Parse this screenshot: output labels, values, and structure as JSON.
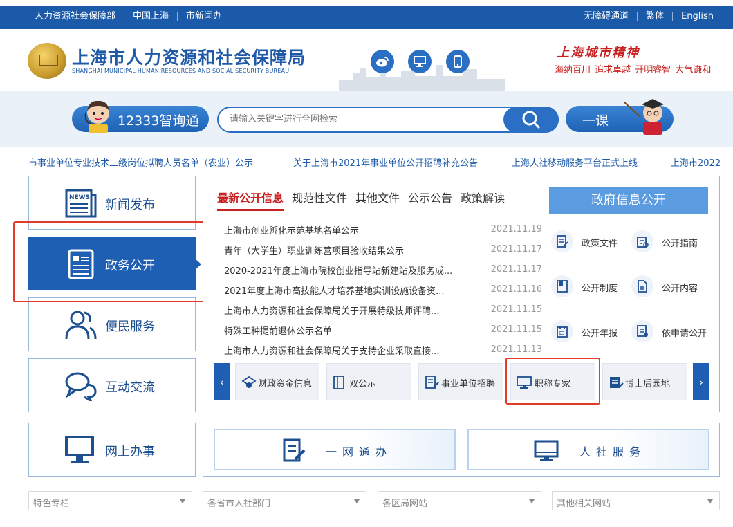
{
  "topbar": {
    "left_links": [
      "人力资源社会保障部",
      "中国上海",
      "市新闻办"
    ],
    "right_links": [
      "无障碍通道",
      "繁体",
      "English"
    ]
  },
  "header": {
    "title": "上海市人力资源和社会保障局",
    "subtitle": "SHANGHAI MUNICIPAL HUMAN RESOURCES AND SOCIAL SECURITY BUREAU",
    "social_icons": [
      "weibo-icon",
      "desktop-icon",
      "mobile-icon"
    ],
    "spirit_title": "上海城市精神",
    "spirit_words": "海纳百川  追求卓越  开明睿智  大气谦和"
  },
  "search": {
    "hotline_label": "12333智询通",
    "placeholder": "请输入关键字进行全网检索",
    "yike_label": "一课"
  },
  "ticker": [
    "市事业单位专业技术二级岗位拟聘人员名单（农业）公示",
    "关于上海市2021年事业单位公开招聘补充公告",
    "上海人社移动服务平台正式上线",
    "上海市2022"
  ],
  "left_nav": [
    {
      "label": "新闻发布",
      "icon": "news-icon"
    },
    {
      "label": "政务公开",
      "icon": "document-icon",
      "active": true
    },
    {
      "label": "便民服务",
      "icon": "people-icon"
    },
    {
      "label": "互动交流",
      "icon": "chat-icon"
    }
  ],
  "tabs": [
    "最新公开信息",
    "规范性文件",
    "其他文件",
    "公示公告",
    "政策解读"
  ],
  "news": [
    {
      "title": "上海市创业孵化示范基地名单公示",
      "date": "2021.11.19"
    },
    {
      "title": "青年（大学生）职业训练营项目验收结果公示",
      "date": "2021.11.17"
    },
    {
      "title": "2020-2021年度上海市院校创业指导站新建站及服务成...",
      "date": "2021.11.17"
    },
    {
      "title": "2021年度上海市高技能人才培养基地实训设施设备资...",
      "date": "2021.11.16"
    },
    {
      "title": "上海市人力资源和社会保障局关于开展特级技师评聘...",
      "date": "2021.11.15"
    },
    {
      "title": "特殊工种提前退休公示名单",
      "date": "2021.11.15"
    },
    {
      "title": "上海市人力资源和社会保障局关于支持企业采取直接...",
      "date": "2021.11.13"
    }
  ],
  "gov": {
    "button": "政府信息公开",
    "items": [
      "政策文件",
      "公开指南",
      "公开制度",
      "公开内容",
      "公开年报",
      "依申请公开"
    ]
  },
  "shortcuts": [
    "财政资金信息",
    "双公示",
    "事业单位招聘",
    "职称专家",
    "博士后园地"
  ],
  "bottom": {
    "online_label": "网上办事",
    "banner1": "一网通办",
    "banner2": "人社服务"
  },
  "selects": [
    "特色专栏",
    "各省市人社部门",
    "各区局网站",
    "其他相关网站"
  ],
  "colors": {
    "primary": "#1f5fb3",
    "accent_red": "#c8201f",
    "highlight_box": "#e23b2c"
  }
}
